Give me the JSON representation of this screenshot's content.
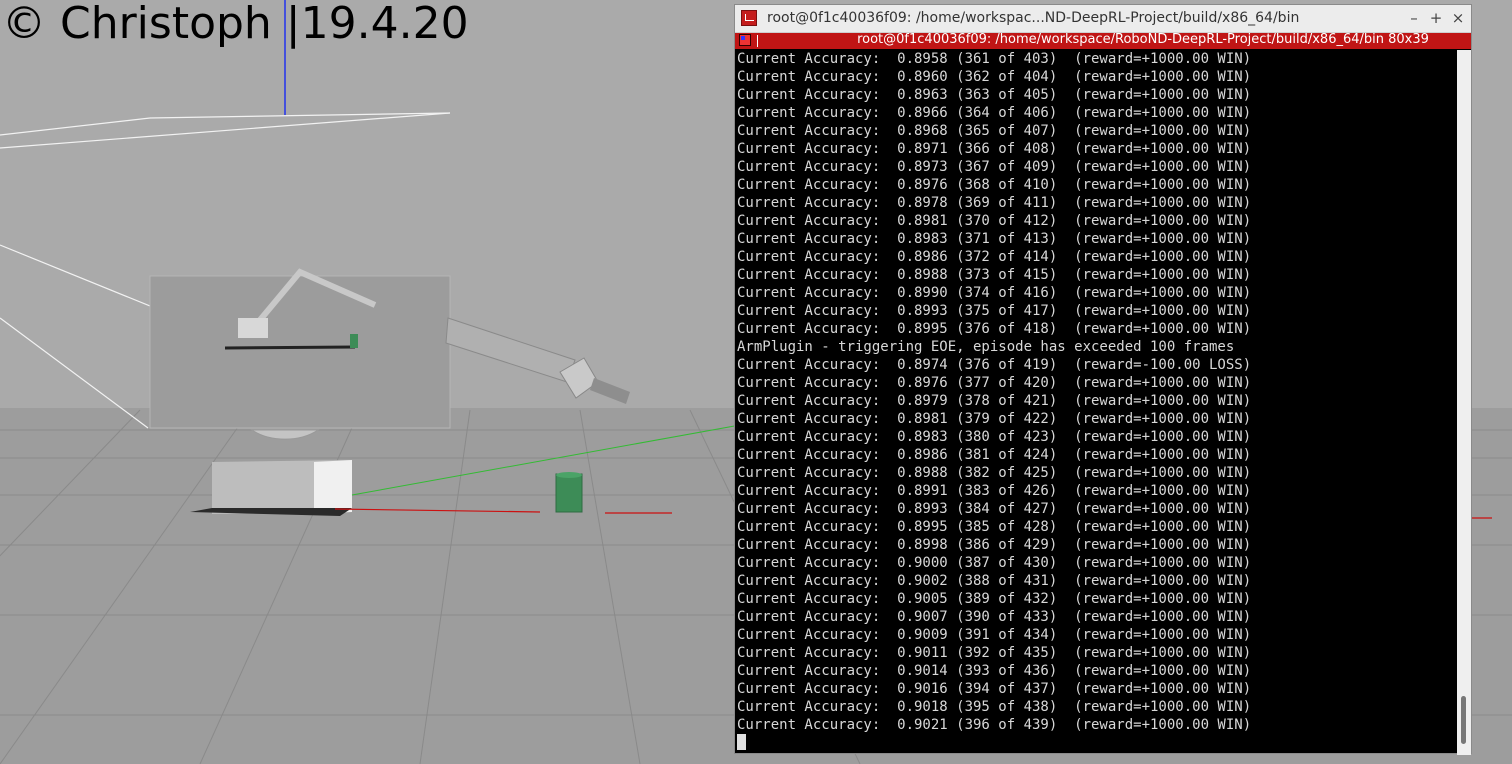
{
  "watermark": "© Christoph |19.4.20",
  "terminal": {
    "window_title": "root@0f1c40036f09: /home/workspac...ND-DeepRL-Project/build/x86_64/bin",
    "tab_title": "root@0f1c40036f09: /home/workspace/RoboND-DeepRL-Project/build/x86_64/bin 80x39",
    "controls": {
      "minimize": "–",
      "maximize": "+",
      "close": "×"
    },
    "lines": [
      "Current Accuracy:  0.8958 (361 of 403)  (reward=+1000.00 WIN)",
      "Current Accuracy:  0.8960 (362 of 404)  (reward=+1000.00 WIN)",
      "Current Accuracy:  0.8963 (363 of 405)  (reward=+1000.00 WIN)",
      "Current Accuracy:  0.8966 (364 of 406)  (reward=+1000.00 WIN)",
      "Current Accuracy:  0.8968 (365 of 407)  (reward=+1000.00 WIN)",
      "Current Accuracy:  0.8971 (366 of 408)  (reward=+1000.00 WIN)",
      "Current Accuracy:  0.8973 (367 of 409)  (reward=+1000.00 WIN)",
      "Current Accuracy:  0.8976 (368 of 410)  (reward=+1000.00 WIN)",
      "Current Accuracy:  0.8978 (369 of 411)  (reward=+1000.00 WIN)",
      "Current Accuracy:  0.8981 (370 of 412)  (reward=+1000.00 WIN)",
      "Current Accuracy:  0.8983 (371 of 413)  (reward=+1000.00 WIN)",
      "Current Accuracy:  0.8986 (372 of 414)  (reward=+1000.00 WIN)",
      "Current Accuracy:  0.8988 (373 of 415)  (reward=+1000.00 WIN)",
      "Current Accuracy:  0.8990 (374 of 416)  (reward=+1000.00 WIN)",
      "Current Accuracy:  0.8993 (375 of 417)  (reward=+1000.00 WIN)",
      "Current Accuracy:  0.8995 (376 of 418)  (reward=+1000.00 WIN)",
      "ArmPlugin - triggering EOE, episode has exceeded 100 frames",
      "Current Accuracy:  0.8974 (376 of 419)  (reward=-100.00 LOSS)",
      "Current Accuracy:  0.8976 (377 of 420)  (reward=+1000.00 WIN)",
      "Current Accuracy:  0.8979 (378 of 421)  (reward=+1000.00 WIN)",
      "Current Accuracy:  0.8981 (379 of 422)  (reward=+1000.00 WIN)",
      "Current Accuracy:  0.8983 (380 of 423)  (reward=+1000.00 WIN)",
      "Current Accuracy:  0.8986 (381 of 424)  (reward=+1000.00 WIN)",
      "Current Accuracy:  0.8988 (382 of 425)  (reward=+1000.00 WIN)",
      "Current Accuracy:  0.8991 (383 of 426)  (reward=+1000.00 WIN)",
      "Current Accuracy:  0.8993 (384 of 427)  (reward=+1000.00 WIN)",
      "Current Accuracy:  0.8995 (385 of 428)  (reward=+1000.00 WIN)",
      "Current Accuracy:  0.8998 (386 of 429)  (reward=+1000.00 WIN)",
      "Current Accuracy:  0.9000 (387 of 430)  (reward=+1000.00 WIN)",
      "Current Accuracy:  0.9002 (388 of 431)  (reward=+1000.00 WIN)",
      "Current Accuracy:  0.9005 (389 of 432)  (reward=+1000.00 WIN)",
      "Current Accuracy:  0.9007 (390 of 433)  (reward=+1000.00 WIN)",
      "Current Accuracy:  0.9009 (391 of 434)  (reward=+1000.00 WIN)",
      "Current Accuracy:  0.9011 (392 of 435)  (reward=+1000.00 WIN)",
      "Current Accuracy:  0.9014 (393 of 436)  (reward=+1000.00 WIN)",
      "Current Accuracy:  0.9016 (394 of 437)  (reward=+1000.00 WIN)",
      "Current Accuracy:  0.9018 (395 of 438)  (reward=+1000.00 WIN)",
      "Current Accuracy:  0.9021 (396 of 439)  (reward=+1000.00 WIN)"
    ]
  },
  "colors": {
    "sky": "#a9a9a9",
    "ground": "#9e9e9e",
    "terminal_bg": "#000000",
    "terminal_text": "#d8d8d8",
    "tab_bar": "#c01515",
    "target_object": "#3d8c57"
  }
}
